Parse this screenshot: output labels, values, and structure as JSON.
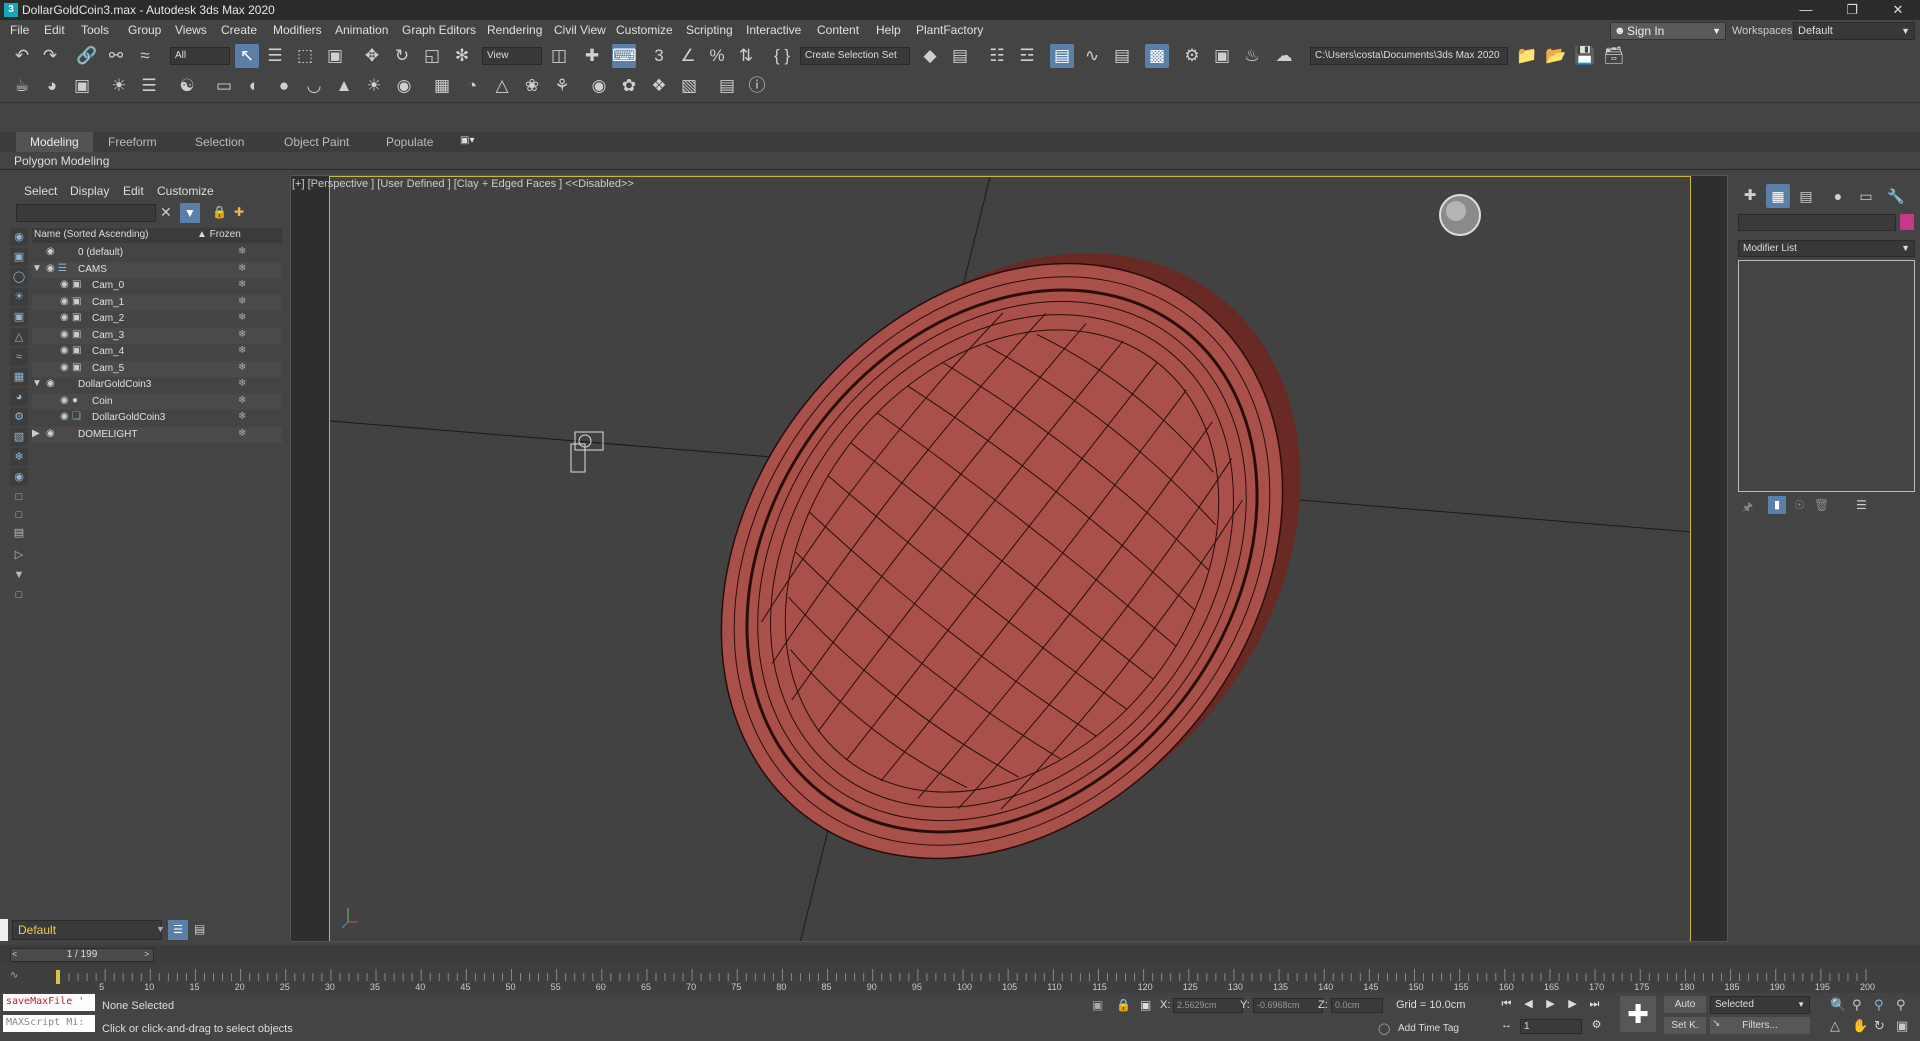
{
  "window": {
    "title": "DollarGoldCoin3.max - Autodesk 3ds Max 2020",
    "icon": "3"
  },
  "menus": [
    "File",
    "Edit",
    "Tools",
    "Group",
    "Views",
    "Create",
    "Modifiers",
    "Animation",
    "Graph Editors",
    "Rendering",
    "Civil View",
    "Customize",
    "Scripting",
    "Interactive",
    "Content",
    "Help",
    "PlantFactory"
  ],
  "signin": "Sign In",
  "workspaces": {
    "label": "Workspaces:",
    "value": "Default"
  },
  "toolbar": {
    "selection_filter": "All",
    "ref_coord": "View",
    "named_selection": "Create Selection Set",
    "project_path": "C:\\Users\\costa\\Documents\\3ds Max 2020"
  },
  "ribbon": {
    "tabs": [
      "Modeling",
      "Freeform",
      "Selection",
      "Object Paint",
      "Populate"
    ],
    "active": "Modeling",
    "panel": "Polygon Modeling"
  },
  "scene_explorer": {
    "tabs": [
      "Select",
      "Display",
      "Edit",
      "Customize"
    ],
    "col_name": "Name (Sorted Ascending)",
    "col_frozen": "▲ Frozen",
    "rows": [
      {
        "label": "0 (default)",
        "indent": 1
      },
      {
        "label": "CAMS",
        "indent": 0
      },
      {
        "label": "Cam_0",
        "indent": 2
      },
      {
        "label": "Cam_1",
        "indent": 2
      },
      {
        "label": "Cam_2",
        "indent": 2
      },
      {
        "label": "Cam_3",
        "indent": 2
      },
      {
        "label": "Cam_4",
        "indent": 2
      },
      {
        "label": "Cam_5",
        "indent": 2
      },
      {
        "label": "DollarGoldCoin3",
        "indent": 1
      },
      {
        "label": "Coin",
        "indent": 2
      },
      {
        "label": "DollarGoldCoin3",
        "indent": 2
      },
      {
        "label": "DOMELIGHT",
        "indent": 1
      }
    ]
  },
  "layer": "Default",
  "viewport": {
    "label": "[+] [Perspective ] [User Defined ] [Clay + Edged Faces ] <<Disabled>>",
    "coin_color": "#a9504a",
    "edge_color": "#2a0c0a"
  },
  "command_panel": {
    "modifier_list": "Modifier List",
    "name_color": "#c43a86"
  },
  "timeline": {
    "frame": "1 / 199",
    "ticks": [
      "5",
      "10",
      "15",
      "20",
      "25",
      "30",
      "35",
      "40",
      "45",
      "50",
      "55",
      "60",
      "65",
      "70",
      "75",
      "80",
      "85",
      "90",
      "95",
      "100",
      "105",
      "110",
      "115",
      "120",
      "125",
      "130",
      "135",
      "140",
      "145",
      "150",
      "155",
      "160",
      "165",
      "170",
      "175",
      "180",
      "185",
      "190",
      "195",
      "200"
    ]
  },
  "status": {
    "maxscript_1": "saveMaxFile '",
    "maxscript_2": "MAXScript Mi:",
    "selection": "None Selected",
    "prompt": "Click or click-and-drag to select objects",
    "x_label": "X:",
    "x_value": "2.5629cm",
    "y_label": "Y:",
    "y_value": "-0.6968cm",
    "z_label": "Z:",
    "z_value": "0.0cm",
    "grid": "Grid = 10.0cm",
    "add_time_tag": "Add Time Tag",
    "auto": "Auto",
    "selected": "Selected",
    "set_key": "Set K.",
    "filters": "Filters...",
    "frame_spinner": "1"
  }
}
